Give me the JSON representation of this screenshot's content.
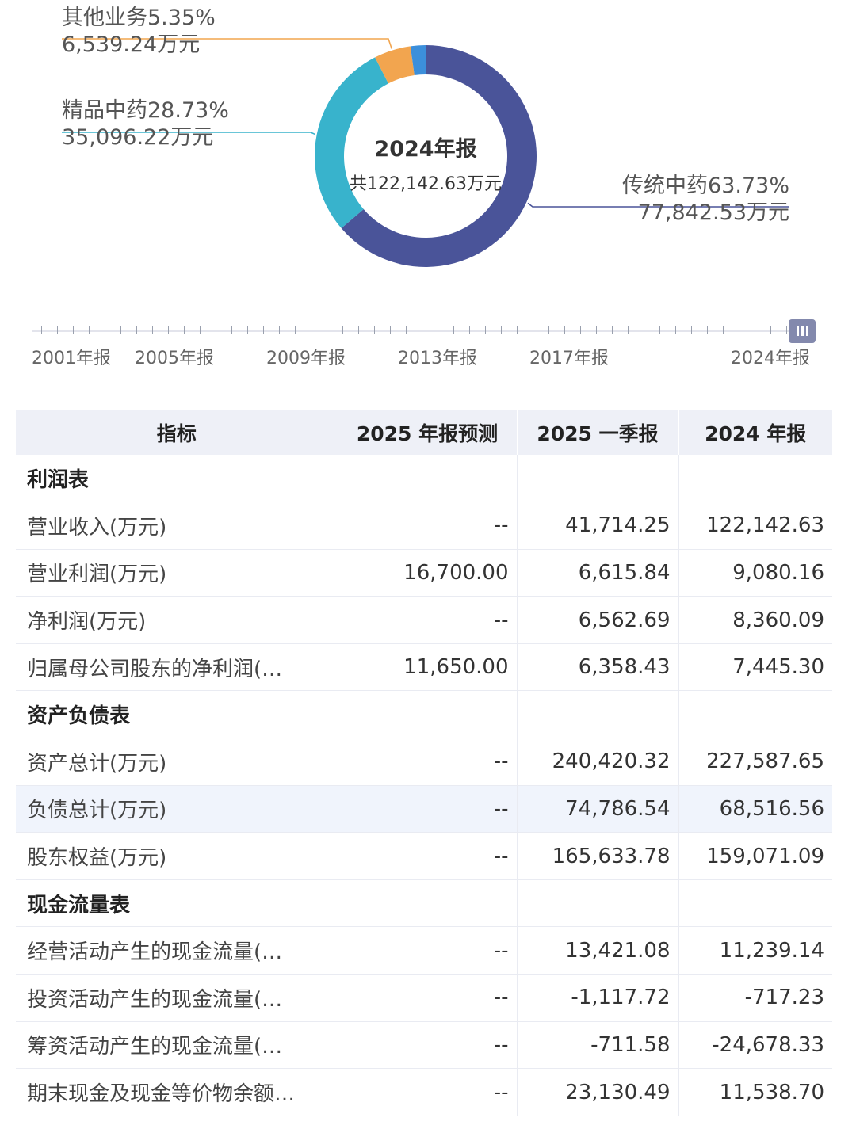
{
  "chart_data": {
    "type": "pie",
    "center_title": "2024年报",
    "center_total": "共122,142.63万元",
    "slices": [
      {
        "name": "传统中药",
        "percent": 63.73,
        "pct_label": "传统中药63.73%",
        "value_label": "77,842.53万元",
        "color": "#4a5499"
      },
      {
        "name": "精品中药",
        "percent": 28.73,
        "pct_label": "精品中药28.73%",
        "value_label": "35,096.22万元",
        "color": "#38b3cc"
      },
      {
        "name": "其他业务",
        "percent": 5.35,
        "pct_label": "其他业务5.35%",
        "value_label": "6,539.24万元",
        "color": "#f2a54f"
      },
      {
        "name": "",
        "percent": 2.19,
        "pct_label": "",
        "value_label": "",
        "color": "#3c8fdb"
      }
    ]
  },
  "timeline": {
    "labels": [
      "2001年报",
      "2005年报",
      "2009年报",
      "2013年报",
      "2017年报",
      "2024年报"
    ],
    "selected": "2024年报"
  },
  "table": {
    "headers": [
      "指标",
      "2025 年报预测",
      "2025 一季报",
      "2024 年报"
    ],
    "rows": [
      {
        "type": "section",
        "cells": [
          "利润表",
          "",
          "",
          ""
        ]
      },
      {
        "type": "data",
        "cells": [
          "营业收入(万元)",
          "--",
          "41,714.25",
          "122,142.63"
        ]
      },
      {
        "type": "data",
        "cells": [
          "营业利润(万元)",
          "16,700.00",
          "6,615.84",
          "9,080.16"
        ]
      },
      {
        "type": "data",
        "cells": [
          "净利润(万元)",
          "--",
          "6,562.69",
          "8,360.09"
        ]
      },
      {
        "type": "data",
        "cells": [
          "归属母公司股东的净利润(…",
          "11,650.00",
          "6,358.43",
          "7,445.30"
        ]
      },
      {
        "type": "section",
        "cells": [
          "资产负债表",
          "",
          "",
          ""
        ]
      },
      {
        "type": "data",
        "cells": [
          "资产总计(万元)",
          "--",
          "240,420.32",
          "227,587.65"
        ]
      },
      {
        "type": "highlight",
        "cells": [
          "负债总计(万元)",
          "--",
          "74,786.54",
          "68,516.56"
        ]
      },
      {
        "type": "data",
        "cells": [
          "股东权益(万元)",
          "--",
          "165,633.78",
          "159,071.09"
        ]
      },
      {
        "type": "section",
        "cells": [
          "现金流量表",
          "",
          "",
          ""
        ]
      },
      {
        "type": "data",
        "cells": [
          "经营活动产生的现金流量(…",
          "--",
          "13,421.08",
          "11,239.14"
        ]
      },
      {
        "type": "data",
        "cells": [
          "投资活动产生的现金流量(…",
          "--",
          "-1,117.72",
          "-717.23"
        ]
      },
      {
        "type": "data",
        "cells": [
          "筹资活动产生的现金流量(…",
          "--",
          "-711.58",
          "-24,678.33"
        ]
      },
      {
        "type": "data",
        "cells": [
          "期末现金及现金等价物余额…",
          "--",
          "23,130.49",
          "11,538.70"
        ]
      }
    ]
  }
}
